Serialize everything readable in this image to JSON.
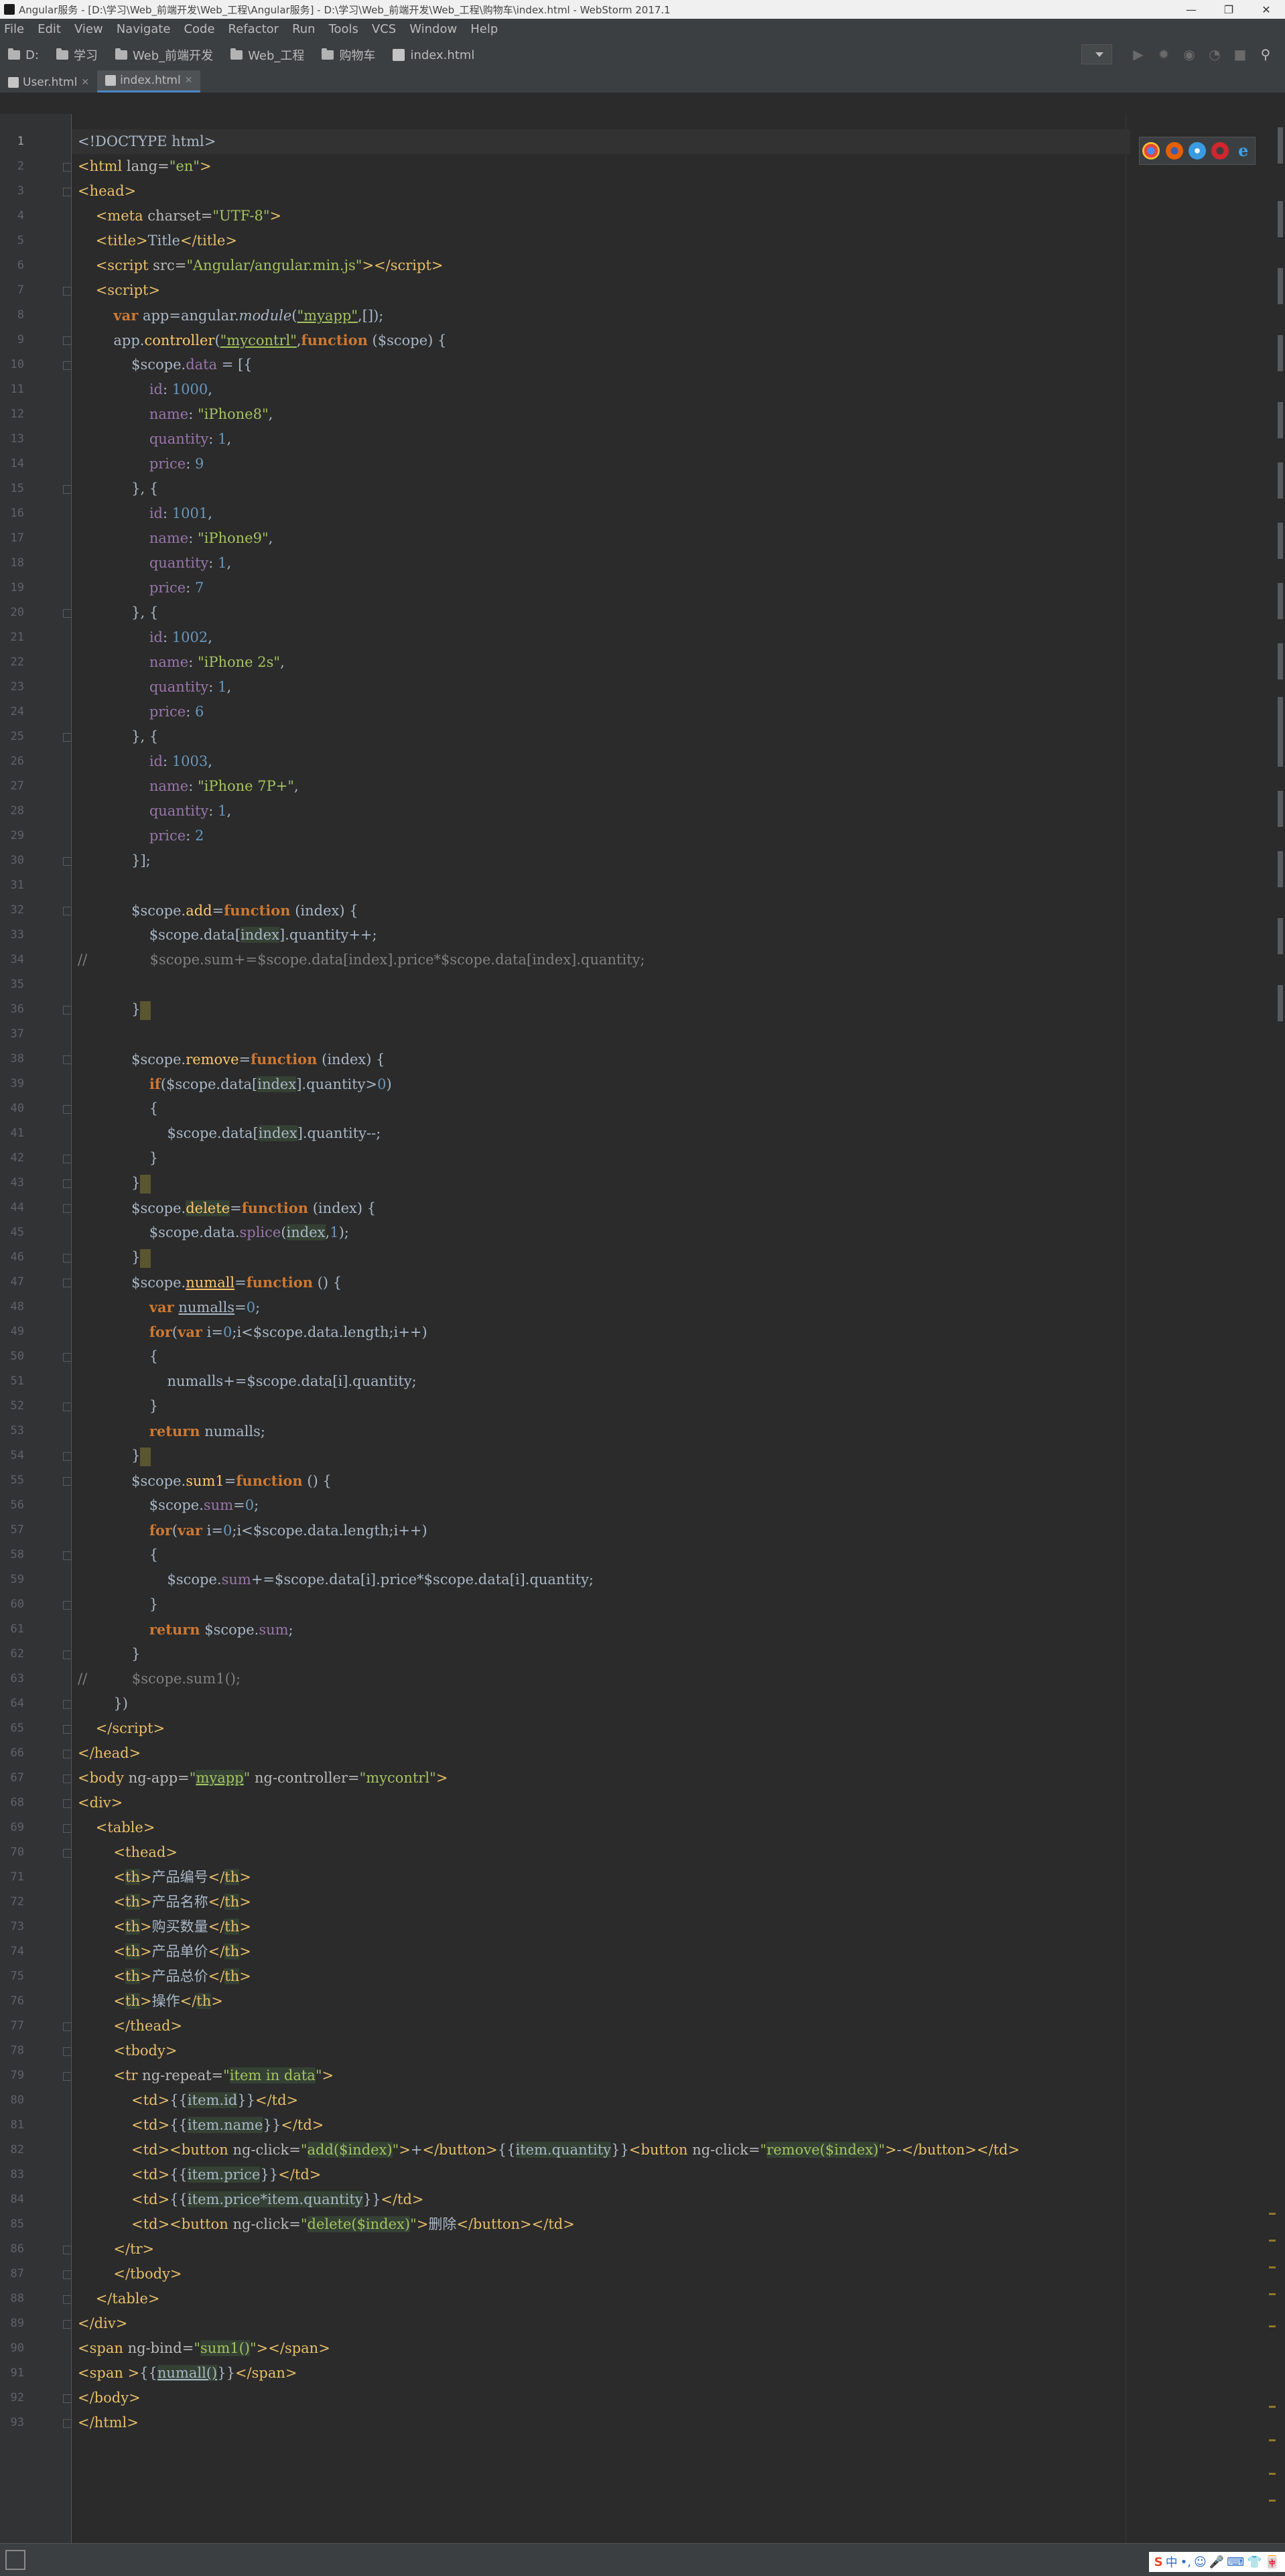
{
  "window": {
    "title": "Angular服务 - [D:\\学习\\Web_前端开发\\Web_工程\\Angular服务] - D:\\学习\\Web_前端开发\\Web_工程\\购物车\\index.html - WebStorm 2017.1",
    "controls": [
      "—",
      "❐",
      "✕"
    ]
  },
  "menu": [
    "File",
    "Edit",
    "View",
    "Navigate",
    "Code",
    "Refactor",
    "Run",
    "Tools",
    "VCS",
    "Window",
    "Help"
  ],
  "breadcrumbs": [
    "D:",
    "学习",
    "Web_前端开发",
    "Web_工程",
    "购物车",
    "index.html"
  ],
  "tabs": [
    {
      "label": "User.html",
      "active": false
    },
    {
      "label": "index.html",
      "active": true
    }
  ],
  "editor": {
    "current_line": 1,
    "browser_icons": [
      "chrome-icon",
      "firefox-icon",
      "safari-icon",
      "opera-icon",
      "ie-icon"
    ],
    "line_numbers": [
      "1",
      "2",
      "3",
      "4",
      "5",
      "6",
      "7",
      "8",
      "9",
      "10",
      "11",
      "12",
      "13",
      "14",
      "15",
      "16",
      "17",
      "18",
      "19",
      "20",
      "21",
      "22",
      "23",
      "24",
      "25",
      "26",
      "27",
      "28",
      "29",
      "30",
      "31",
      "32",
      "33",
      "34",
      "35",
      "36",
      "37",
      "38",
      "39",
      "40",
      "41",
      "42",
      "43",
      "44",
      "45",
      "46",
      "47",
      "48",
      "49",
      "50",
      "51",
      "52",
      "53",
      "54",
      "55",
      "56",
      "57",
      "58",
      "59",
      "60",
      "61",
      "62",
      "63",
      "64",
      "65",
      "66",
      "67",
      "68",
      "69",
      "70",
      "71",
      "72",
      "73",
      "74",
      "75",
      "76",
      "77",
      "78",
      "79",
      "80",
      "81",
      "82",
      "83",
      "84",
      "85",
      "86",
      "87",
      "88",
      "89",
      "90",
      "91",
      "92",
      "93"
    ]
  },
  "status": {
    "tray": [
      "S",
      "中",
      "•,",
      "☺",
      "🎤",
      "⌨",
      "👕",
      "🀄"
    ]
  }
}
